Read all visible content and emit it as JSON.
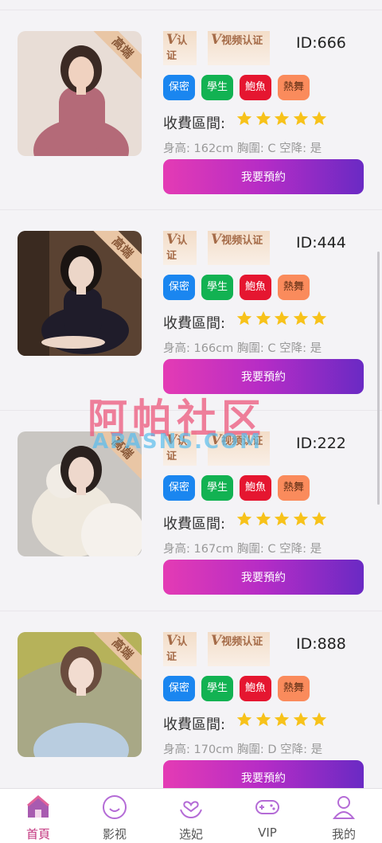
{
  "cards": [
    {
      "id_text": "ID:666",
      "corner_label": "高端",
      "badge_identity": "认证",
      "badge_video": "视频认证",
      "badge_v": "V",
      "tags": [
        "保密",
        "學生",
        "鮑魚",
        "熱舞"
      ],
      "fee_label": "收費區間:",
      "rating": 5,
      "stats": "身高: 162cm 胸圍: C 空降: 是",
      "book_label": "我要預約",
      "photo_colors": {
        "bg": "#e8ddd6",
        "top": "#b46a78",
        "hair": "#3b2a24",
        "skin": "#f0d2c0"
      }
    },
    {
      "id_text": "ID:444",
      "corner_label": "高端",
      "badge_identity": "认证",
      "badge_video": "视频认证",
      "badge_v": "V",
      "tags": [
        "保密",
        "學生",
        "鮑魚",
        "熱舞"
      ],
      "fee_label": "收費區間:",
      "rating": 5,
      "stats": "身高: 166cm 胸圍: C 空降: 是",
      "book_label": "我要預約",
      "photo_colors": {
        "bg": "#5a4232",
        "top": "#1f1c2a",
        "hair": "#1a1412",
        "skin": "#ecd6c8"
      }
    },
    {
      "id_text": "ID:222",
      "corner_label": "高端",
      "badge_identity": "认证",
      "badge_video": "视频认证",
      "badge_v": "V",
      "tags": [
        "保密",
        "學生",
        "鮑魚",
        "熱舞"
      ],
      "fee_label": "收費區間:",
      "rating": 5,
      "stats": "身高: 167cm 胸圍: C 空降: 是",
      "book_label": "我要預約",
      "photo_colors": {
        "bg": "#c9c6c2",
        "top": "#efe9de",
        "hair": "#2a211e",
        "skin": "#eed8cc"
      }
    },
    {
      "id_text": "ID:888",
      "corner_label": "高端",
      "badge_identity": "认证",
      "badge_video": "视频认证",
      "badge_v": "V",
      "tags": [
        "保密",
        "學生",
        "鮑魚",
        "熱舞"
      ],
      "fee_label": "收費區間:",
      "rating": 5,
      "stats": "身高: 170cm 胸圍: D 空降: 是",
      "book_label": "我要預約",
      "photo_colors": {
        "bg": "#a8a886",
        "top": "#b9cde0",
        "hair": "#6a4c3e",
        "skin": "#f2dcd0"
      }
    }
  ],
  "watermark": {
    "title": "阿帕社区",
    "subtitle": "APASNS.COM"
  },
  "tabbar": {
    "items": [
      {
        "label": "首頁",
        "icon": "home-icon",
        "active": true
      },
      {
        "label": "影视",
        "icon": "smile-icon",
        "active": false
      },
      {
        "label": "选妃",
        "icon": "heart-hands-icon",
        "active": false
      },
      {
        "label": "VIP",
        "icon": "gamepad-icon",
        "active": false
      },
      {
        "label": "我的",
        "icon": "user-icon",
        "active": false
      }
    ]
  },
  "colors": {
    "accent": "#c2337d",
    "star": "#f7c21a",
    "gradient_start": "#e43bb4",
    "gradient_end": "#6a2ac4"
  }
}
